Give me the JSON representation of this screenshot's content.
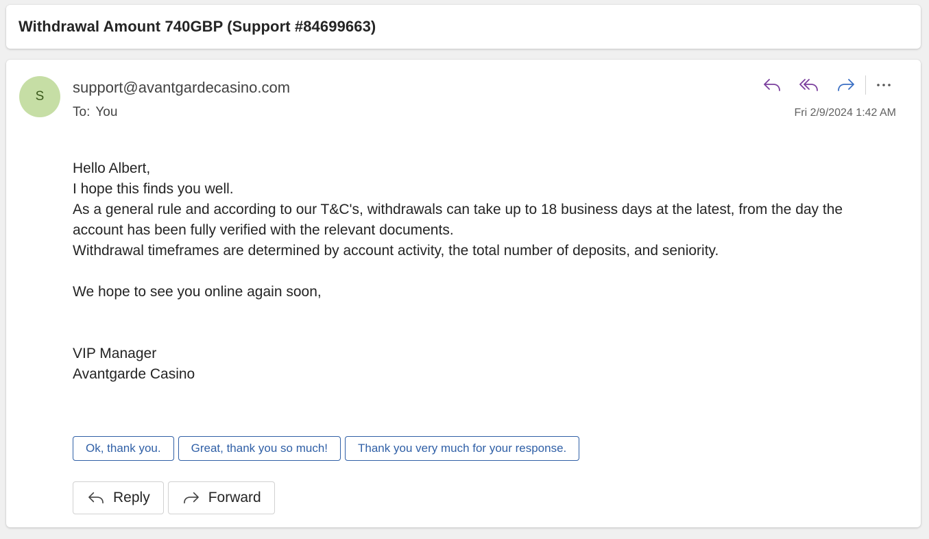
{
  "subject": "Withdrawal Amount 740GBP (Support #84699663)",
  "message": {
    "avatar_initial": "S",
    "sender": "support@avantgardecasino.com",
    "to_label": "To:",
    "to_value": "You",
    "timestamp": "Fri 2/9/2024 1:42 AM",
    "body": {
      "greeting": "Hello Albert,",
      "line1": "I hope this finds you well.",
      "line2": "As a general rule and according to our T&C's, withdrawals can take up to 18 business days at the latest, from the day the account has been fully verified with the relevant documents.",
      "line3": "Withdrawal timeframes are determined by account activity, the total number of deposits, and seniority.",
      "closing": "We hope to see you online again soon,",
      "signature_title": "VIP Manager",
      "signature_company": "Avantgarde Casino"
    }
  },
  "toolbar_icons": [
    "reply-icon",
    "reply-all-icon",
    "forward-icon",
    "more-icon"
  ],
  "quick_replies": [
    "Ok, thank you.",
    "Great, thank you so much!",
    "Thank you very much for your response."
  ],
  "buttons": {
    "reply": "Reply",
    "forward": "Forward"
  },
  "colors": {
    "avatar_bg": "#c6dea5",
    "reply_icon": "#7a3e9d",
    "forward_icon": "#3a6fc4",
    "quick_reply_accent": "#2f5fa6"
  }
}
